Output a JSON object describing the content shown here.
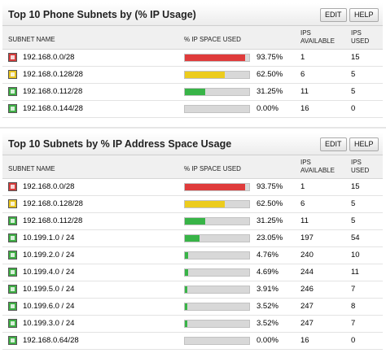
{
  "columns": {
    "subnet": "SUBNET NAME",
    "space": "% IP SPACE USED",
    "avail_1": "IPS",
    "avail_2": "AVAILABLE",
    "used_1": "IPS",
    "used_2": "USED"
  },
  "buttons": {
    "edit": "EDIT",
    "help": "HELP"
  },
  "colors": {
    "red": "#df3b3b",
    "yellow": "#eccc1d",
    "green": "#38b447"
  },
  "widgets": [
    {
      "title": "Top 10 Phone Subnets by (% IP Usage)",
      "rows": [
        {
          "name": "192.168.0.0/28",
          "pct_text": "93.75%",
          "pct": 93.75,
          "status": "red",
          "avail": "1",
          "used": "15"
        },
        {
          "name": "192.168.0.128/28",
          "pct_text": "62.50%",
          "pct": 62.5,
          "status": "yellow",
          "avail": "6",
          "used": "5"
        },
        {
          "name": "192.168.0.112/28",
          "pct_text": "31.25%",
          "pct": 31.25,
          "status": "green",
          "avail": "11",
          "used": "5"
        },
        {
          "name": "192.168.0.144/28",
          "pct_text": "0.00%",
          "pct": 0,
          "status": "green",
          "avail": "16",
          "used": "0"
        }
      ]
    },
    {
      "title": "Top 10 Subnets by % IP Address Space Usage",
      "rows": [
        {
          "name": "192.168.0.0/28",
          "pct_text": "93.75%",
          "pct": 93.75,
          "status": "red",
          "avail": "1",
          "used": "15"
        },
        {
          "name": "192.168.0.128/28",
          "pct_text": "62.50%",
          "pct": 62.5,
          "status": "yellow",
          "avail": "6",
          "used": "5"
        },
        {
          "name": "192.168.0.112/28",
          "pct_text": "31.25%",
          "pct": 31.25,
          "status": "green",
          "avail": "11",
          "used": "5"
        },
        {
          "name": "10.199.1.0 / 24",
          "pct_text": "23.05%",
          "pct": 23.05,
          "status": "green",
          "avail": "197",
          "used": "54"
        },
        {
          "name": "10.199.2.0 / 24",
          "pct_text": "4.76%",
          "pct": 4.76,
          "status": "green",
          "avail": "240",
          "used": "10"
        },
        {
          "name": "10.199.4.0 / 24",
          "pct_text": "4.69%",
          "pct": 4.69,
          "status": "green",
          "avail": "244",
          "used": "11"
        },
        {
          "name": "10.199.5.0 / 24",
          "pct_text": "3.91%",
          "pct": 3.91,
          "status": "green",
          "avail": "246",
          "used": "7"
        },
        {
          "name": "10.199.6.0 / 24",
          "pct_text": "3.52%",
          "pct": 3.52,
          "status": "green",
          "avail": "247",
          "used": "8"
        },
        {
          "name": "10.199.3.0 / 24",
          "pct_text": "3.52%",
          "pct": 3.52,
          "status": "green",
          "avail": "247",
          "used": "7"
        },
        {
          "name": "192.168.0.64/28",
          "pct_text": "0.00%",
          "pct": 0,
          "status": "green",
          "avail": "16",
          "used": "0"
        }
      ]
    }
  ]
}
